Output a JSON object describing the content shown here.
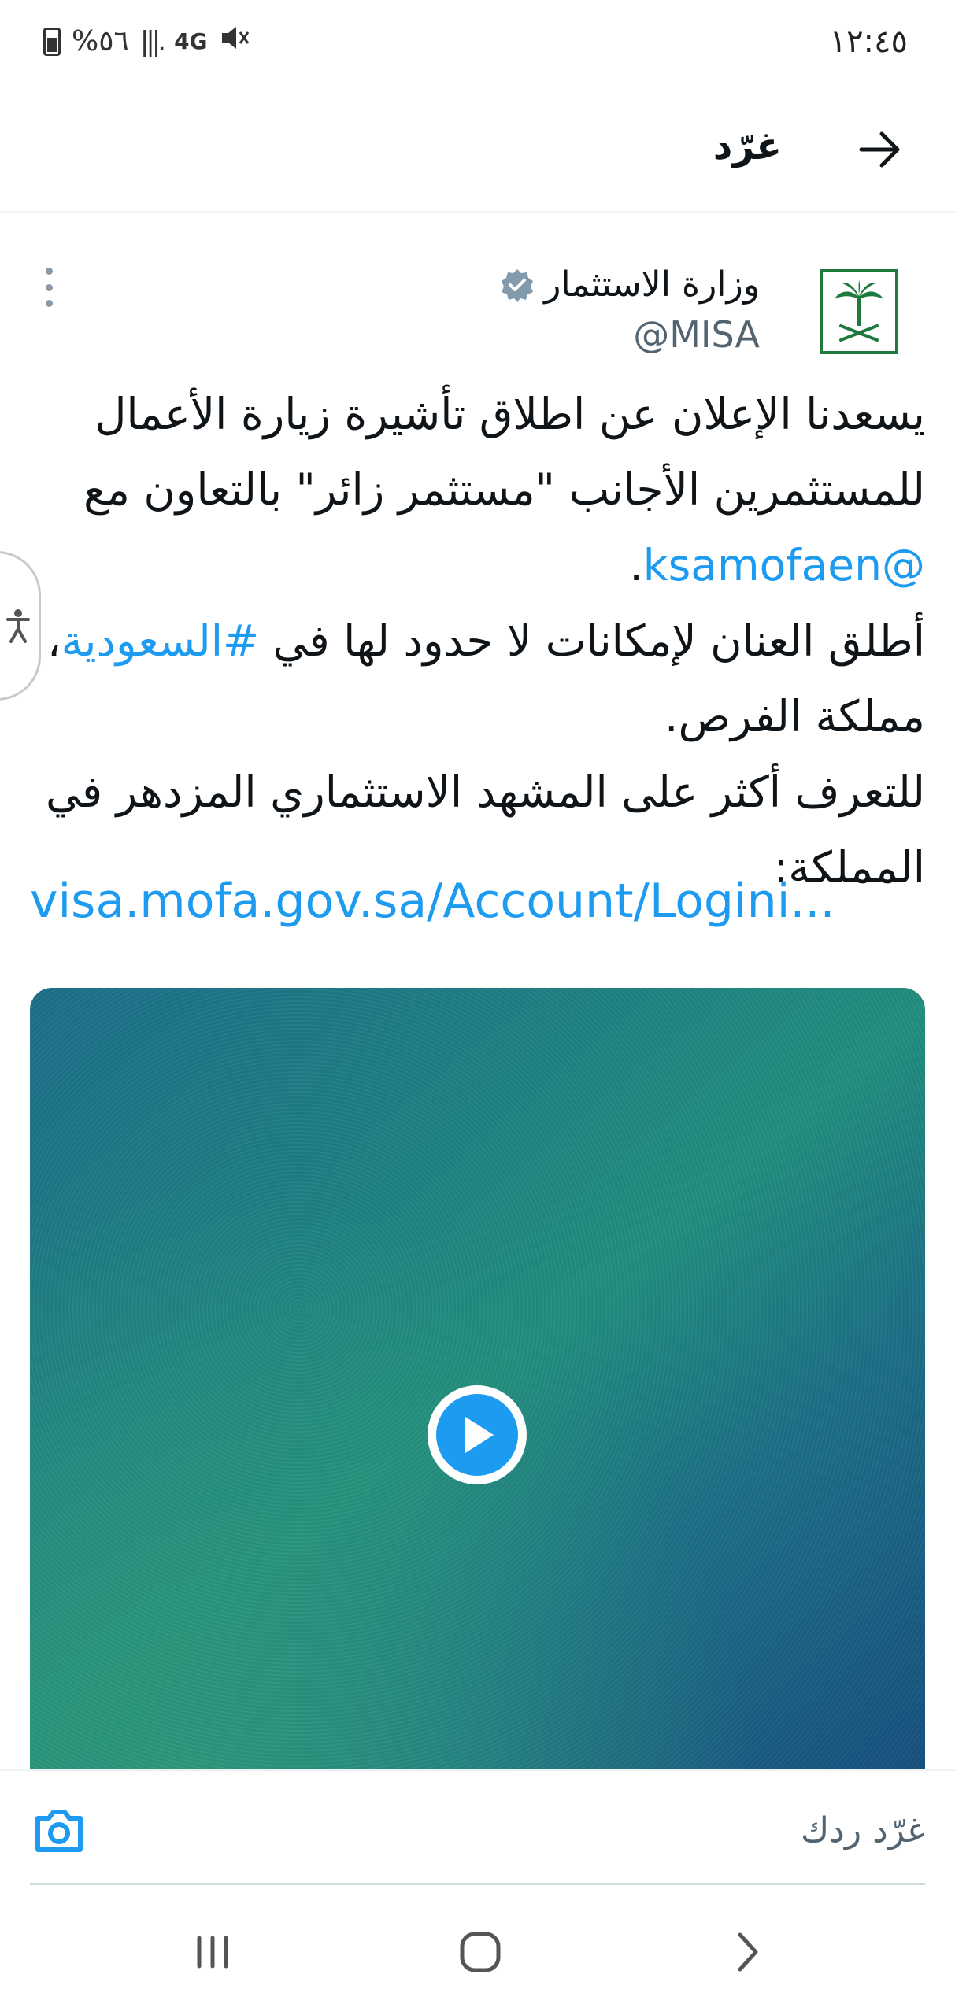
{
  "status_bar": {
    "time": "١٢:٤٥",
    "battery": "%٥٦",
    "network": "4G",
    "signal": "|||.",
    "mute_icon": "mute-icon"
  },
  "header": {
    "title": "غرّد",
    "back_icon": "arrow-right-icon"
  },
  "tweet": {
    "author_name": "وزارة الاستثمار",
    "handle": "@MISA",
    "verified": true,
    "line1": "يسعدنا الإعلان عن اطلاق تأشيرة زيارة الأعمال للمستثمرين الأجانب \"مستثمر زائر\" بالتعاون مع",
    "mention": "@ksamofaen",
    "mention_end": ".",
    "line2_start": "أطلق العنان لإمكانات لا حدود لها في ",
    "hashtag": "#السعودية",
    "line2_end": "، مملكة الفرص.",
    "line3": "للتعرف أكثر على المشهد الاستثماري المزدهر في المملكة:",
    "url": "visa.mofa.gov.sa/Account/Logini...",
    "media_type": "video"
  },
  "reply": {
    "placeholder": "غرّد ردك",
    "camera_icon": "camera-icon"
  },
  "colors": {
    "accent": "#1d9bf0",
    "text": "#0f1419",
    "secondary": "#536471",
    "logo_green": "#1e7a3c"
  }
}
